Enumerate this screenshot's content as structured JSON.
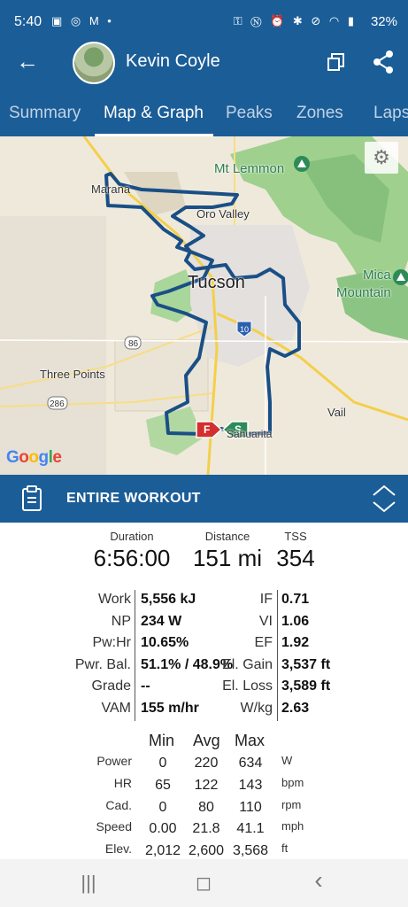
{
  "status": {
    "time": "5:40",
    "left_icons": "▣ ◎ M •",
    "right_icons": "⚿ Ⓝ ⏰ ✱ ⊘ ◠ ▮",
    "battery": "32%"
  },
  "header": {
    "name": "Kevin Coyle"
  },
  "tabs": [
    "Summary",
    "Map & Graph",
    "Peaks",
    "Zones",
    "Laps"
  ],
  "map": {
    "labels": {
      "marana": "Marana",
      "oro_valley": "Oro Valley",
      "mt_lemmon": "Mt Lemmon",
      "tucson": "Tucson",
      "mica": "Mica",
      "mountain": "Mountain",
      "three_points": "Three Points",
      "vail": "Vail",
      "sahuarita": "Sahuarita",
      "route86": "86",
      "route286": "286",
      "route10": "10"
    },
    "marker_finish": "F",
    "marker_start": "S",
    "google": [
      "G",
      "o",
      "o",
      "g",
      "l",
      "e"
    ]
  },
  "workout_bar": {
    "title": "ENTIRE WORKOUT"
  },
  "summary": {
    "duration_label": "Duration",
    "duration": "6:56:00",
    "distance_label": "Distance",
    "distance": "151 mi",
    "tss_label": "TSS",
    "tss": "354"
  },
  "metrics": {
    "left": [
      {
        "key": "Work",
        "val": "5,556 kJ"
      },
      {
        "key": "NP",
        "val": "234 W"
      },
      {
        "key": "Pw:Hr",
        "val": "10.65%"
      },
      {
        "key": "Pwr. Bal.",
        "val": "51.1% / 48.9%"
      },
      {
        "key": "Grade",
        "val": "--"
      },
      {
        "key": "VAM",
        "val": "155 m/hr"
      }
    ],
    "right": [
      {
        "key": "IF",
        "val": "0.71"
      },
      {
        "key": "VI",
        "val": "1.06"
      },
      {
        "key": "EF",
        "val": "1.92"
      },
      {
        "key": "El. Gain",
        "val": "3,537 ft"
      },
      {
        "key": "El. Loss",
        "val": "3,589 ft"
      },
      {
        "key": "W/kg",
        "val": "2.63"
      }
    ]
  },
  "stats": {
    "headers": [
      "Min",
      "Avg",
      "Max"
    ],
    "rows": [
      {
        "key": "Power",
        "min": "0",
        "avg": "220",
        "max": "634",
        "unit": "W"
      },
      {
        "key": "HR",
        "min": "65",
        "avg": "122",
        "max": "143",
        "unit": "bpm"
      },
      {
        "key": "Cad.",
        "min": "0",
        "avg": "80",
        "max": "110",
        "unit": "rpm"
      },
      {
        "key": "Speed",
        "min": "0.00",
        "avg": "21.8",
        "max": "41.1",
        "unit": "mph"
      },
      {
        "key": "Elev.",
        "min": "2,012",
        "avg": "2,600",
        "max": "3,568",
        "unit": "ft"
      }
    ]
  },
  "navbar": {
    "recent": "|||",
    "home": "◻",
    "back": "‹"
  },
  "colors": {
    "brand": "#1b5d97",
    "route": "#1a4f86",
    "park": "#b8dcaa",
    "forest": "#86c07c"
  }
}
